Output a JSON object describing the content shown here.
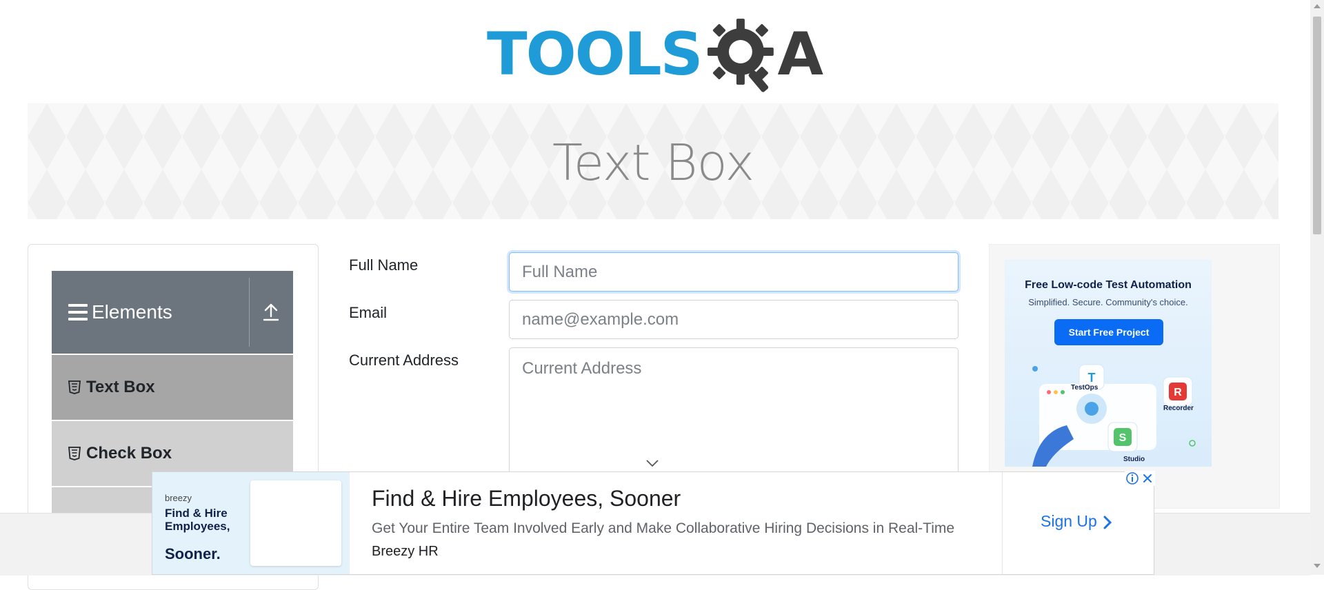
{
  "header": {
    "logo_left": "TOOLS",
    "logo_right": "A"
  },
  "banner": {
    "title": "Text Box"
  },
  "sidebar": {
    "group_title": "Elements",
    "items": [
      {
        "label": "Text Box"
      },
      {
        "label": "Check Box"
      }
    ]
  },
  "form": {
    "full_name_label": "Full Name",
    "full_name_placeholder": "Full Name",
    "email_label": "Email",
    "email_placeholder": "name@example.com",
    "address_label": "Current Address",
    "address_placeholder": "Current Address"
  },
  "ad_right": {
    "headline": "Free Low-code Test Automation",
    "subline": "Simplified. Secure. Community's choice.",
    "button": "Start Free Project",
    "tiles": [
      "TestOps",
      "Recorder",
      "Studio"
    ],
    "accent": "#0a6cf5"
  },
  "ad_bottom": {
    "brand": "breezy",
    "tagline": "Find & Hire Employees,",
    "tagline_emphasis": "Sooner.",
    "headline": "Find & Hire Employees, Sooner",
    "description": "Get Your Entire Team Involved Early and Make Collaborative Hiring Decisions in Real-Time",
    "advertiser": "Breezy HR",
    "cta": "Sign Up"
  },
  "colors": {
    "brand_blue": "#1f9cd8",
    "group_header": "#6c757d",
    "active_item": "#a6a6a6",
    "link": "#1a73e8"
  }
}
